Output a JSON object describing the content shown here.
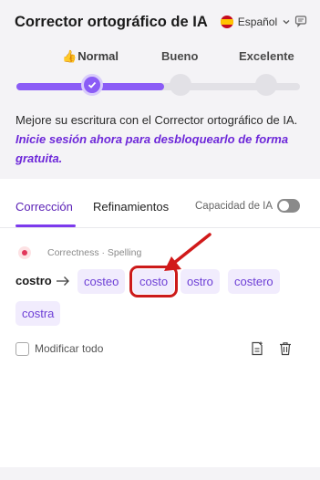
{
  "header": {
    "title": "Corrector ortográfico de IA",
    "language": "Español"
  },
  "levels": {
    "items": [
      {
        "label": "Normal",
        "icon": "thumbs-up-icon"
      },
      {
        "label": "Bueno"
      },
      {
        "label": "Excelente"
      }
    ],
    "selected_index": 0,
    "progress_fraction": 0.52
  },
  "promo": {
    "text": "Mejore su escritura con el Corrector ortográfico de IA. ",
    "link": "Inicie sesión ahora para desbloquearlo de forma gratuita."
  },
  "tabs": {
    "correction": "Corrección",
    "refinements": "Refinamientos",
    "ai_capacity": "Capacidad de IA",
    "ai_capacity_on": false
  },
  "suggestion": {
    "category": "Correctness · Spelling",
    "word": "costro",
    "options": [
      "costeo",
      "costo",
      "ostro",
      "costero",
      "costra"
    ],
    "highlighted_option": "costo"
  },
  "footer": {
    "modify_all": "Modificar todo"
  },
  "colors": {
    "accent": "#8b5cf6",
    "chip_text": "#6d3fd6",
    "chip_bg": "#f1ecfd",
    "annotation_red": "#cc1a1a"
  }
}
